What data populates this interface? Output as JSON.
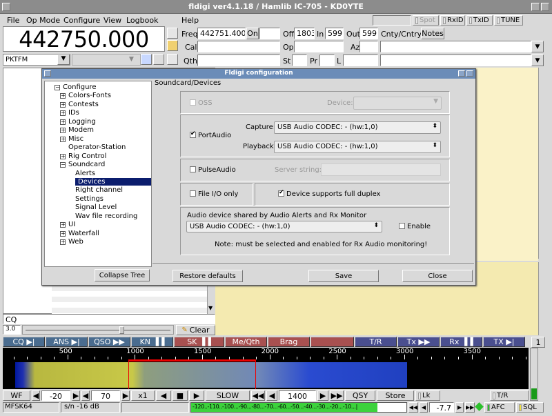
{
  "app": {
    "title": "fldigi ver4.1.18 / Hamlib IC-705 - KD0YTE"
  },
  "menu": {
    "file": "File",
    "opmode": "Op Mode",
    "configure": "Configure",
    "view": "View",
    "logbook": "Logbook",
    "help": "Help"
  },
  "toggles": {
    "spot": "Spot",
    "rxid": "RxID",
    "txid": "TxID",
    "tune": "TUNE"
  },
  "frequency": {
    "display": "442750.000",
    "mode": "PKTFM"
  },
  "log": {
    "freq_label": "Freq",
    "freq_value": "442751.400",
    "on_label": "On",
    "off_label": "Off",
    "off_value": "1803",
    "in_label": "In",
    "in_value": "599",
    "out_label": "Out",
    "out_value": "599",
    "cnty_label": "Cnty/Cntry",
    "notes_label": "Notes",
    "call_label": "Call",
    "op_label": "Op",
    "az_label": "Az",
    "qth_label": "Qth",
    "st_label": "St",
    "pr_label": "Pr",
    "l_label": "L"
  },
  "dialog": {
    "title": "Fldigi configuration",
    "section": "Soundcard/Devices",
    "oss_label": "OSS",
    "device_label": "Device:",
    "portaudio_label": "PortAudio",
    "capture_label": "Capture:",
    "capture_value": "USB Audio CODEC: - (hw:1,0)",
    "playback_label": "Playback:",
    "playback_value": "USB Audio CODEC: - (hw:1,0)",
    "pulse_label": "PulseAudio",
    "server_label": "Server string:",
    "fileio_label": "File I/O only",
    "duplex_label": "Device supports full duplex",
    "shared_title": "Audio device shared by Audio Alerts and Rx Monitor",
    "shared_value": "USB Audio CODEC: - (hw:1,0)",
    "enable_label": "Enable",
    "note": "Note: must be selected and enabled for Rx Audio monitoring!",
    "collapse_btn": "Collapse Tree",
    "restore_btn": "Restore defaults",
    "save_btn": "Save",
    "close_btn": "Close",
    "tree": [
      "Configure",
      "Colors-Fonts",
      "Contests",
      "IDs",
      "Logging",
      "Modem",
      "Misc",
      "Operator-Station",
      "Rig Control",
      "Soundcard",
      "Alerts",
      "Devices",
      "Right channel",
      "Settings",
      "Signal Level",
      "Wav file recording",
      "UI",
      "Waterfall",
      "Web"
    ]
  },
  "rx": {
    "cq_text": "CQ",
    "squelch_value": "3.0",
    "clear_label": "Clear"
  },
  "macros": [
    "CQ ▶|",
    "ANS ▶|",
    "QSO ▶▶",
    "KN ▐▐",
    "SK ▐▐",
    "Me/Qth",
    "Brag",
    "",
    "T/R",
    "Tx ▶▶",
    "Rx ▐▐",
    "TX ▶|"
  ],
  "macro_page": "1",
  "scale": [
    "500",
    "1000",
    "1500",
    "2000",
    "2500",
    "3000",
    "3500"
  ],
  "wfbar": {
    "wf": "WF",
    "lo": "-20",
    "hi": "70",
    "zoom": "x1",
    "speed": "SLOW",
    "freq": "1400",
    "qsy": "QSY",
    "store": "Store",
    "lk": "Lk",
    "tr": "T/R"
  },
  "status": {
    "mode": "MFSK64",
    "sn": "s/n -16 dB",
    "meter": "-120..-110..-100...-90...-80...-70...-60...-50...-40...-30...-20...-10...|",
    "value": "-7.7",
    "afc": "AFC",
    "sql": "SQL"
  },
  "colors": {
    "titlebar": "#8c8c8c",
    "dialog_title": "#6b8cb8",
    "freq_bg": "#ffffff",
    "macro_blue": "#4a6c8f",
    "macro_red": "#a85050",
    "macro_purple": "#4a4f8f",
    "tree_select": "#0b1d6d"
  }
}
